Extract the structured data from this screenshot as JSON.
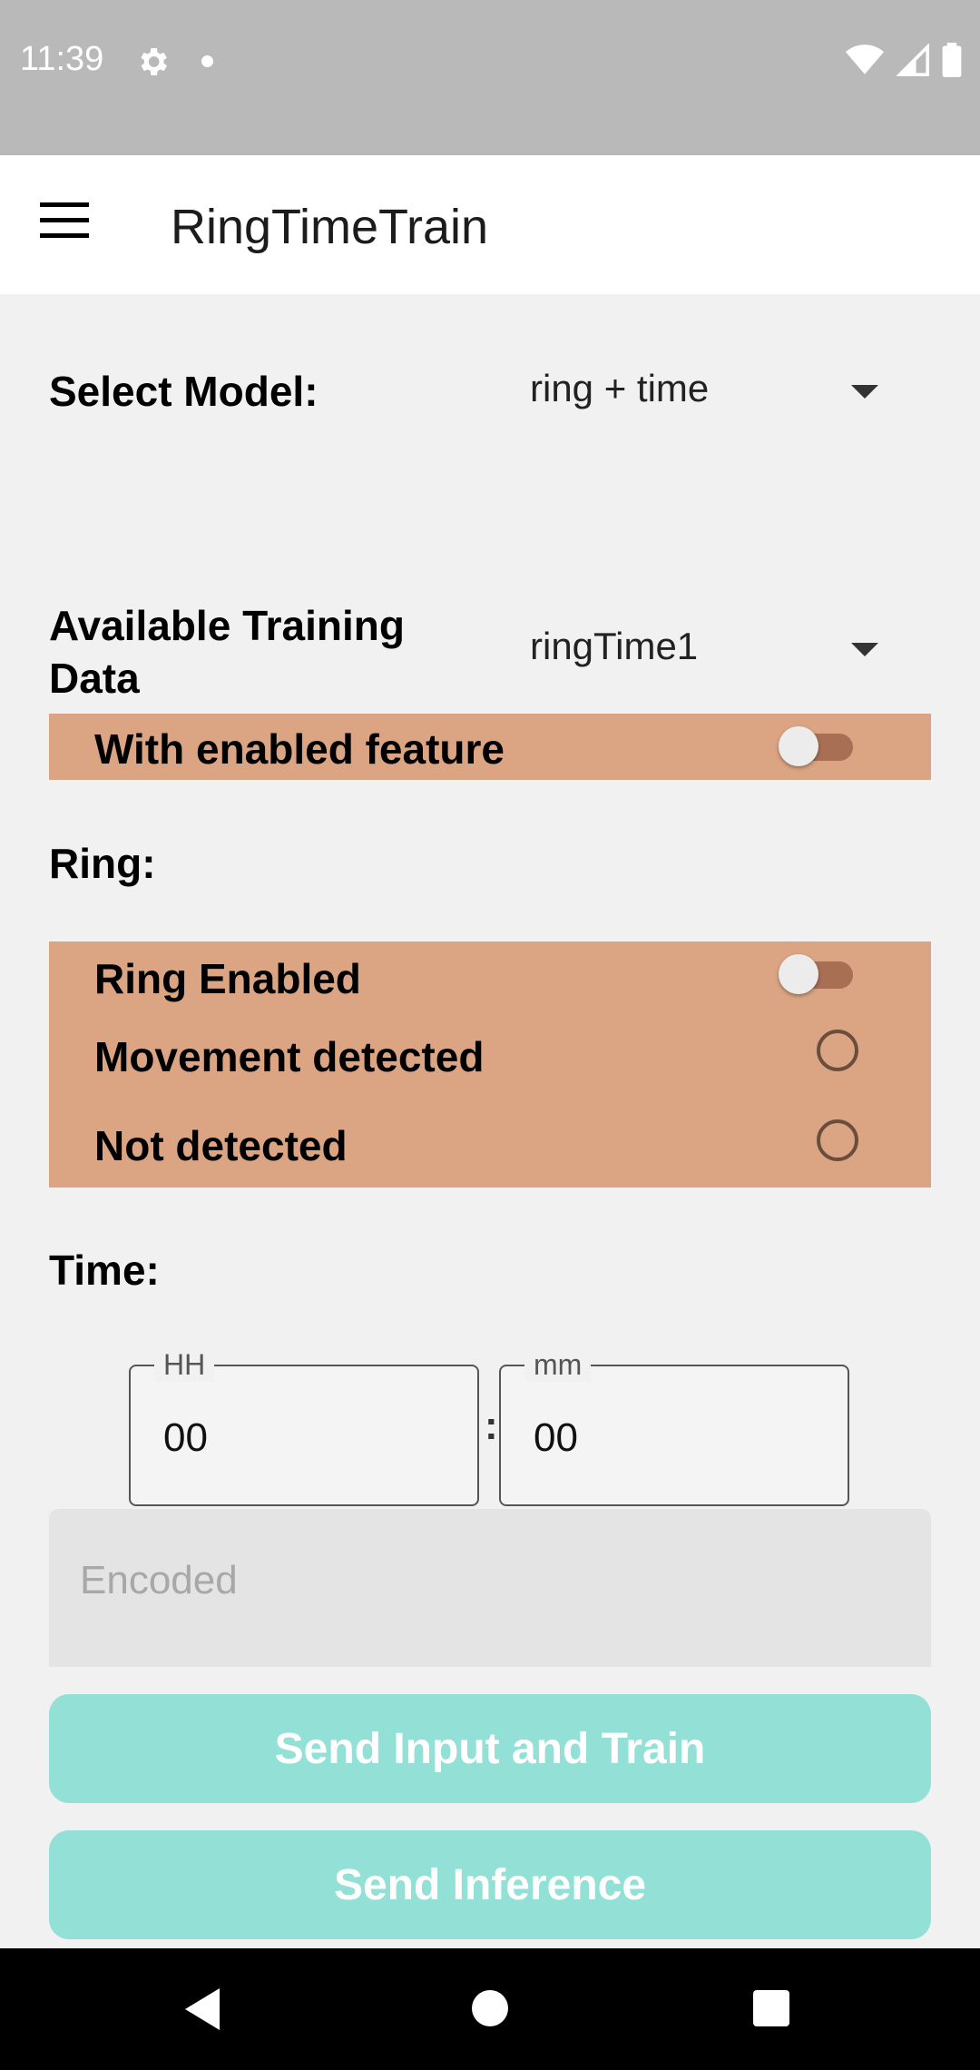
{
  "status_bar": {
    "time": "11:39"
  },
  "app_bar": {
    "title": "RingTimeTrain"
  },
  "model": {
    "label": "Select Model:",
    "selected": "ring + time"
  },
  "training_data": {
    "label": "Available Training Data",
    "selected": "ringTime1"
  },
  "enabled_feature": {
    "label": "With enabled feature",
    "on": false
  },
  "ring": {
    "heading": "Ring:",
    "enabled_label": "Ring Enabled",
    "enabled_on": false,
    "movement_label": "Movement detected",
    "not_detected_label": "Not detected"
  },
  "time": {
    "heading": "Time:",
    "hours_label": "HH",
    "hours_value": "00",
    "separator": ":",
    "minutes_label": "mm",
    "minutes_value": "00"
  },
  "encoded": {
    "placeholder": "Encoded"
  },
  "buttons": {
    "train": "Send Input and Train",
    "inference": "Send Inference"
  },
  "colors": {
    "accent_panel": "#dba584",
    "button_teal": "#92e0d6"
  },
  "icons": {
    "status": [
      "gear-icon",
      "wifi-icon",
      "signal-icon",
      "battery-icon"
    ],
    "nav": [
      "back-icon",
      "home-icon",
      "recents-icon"
    ]
  }
}
